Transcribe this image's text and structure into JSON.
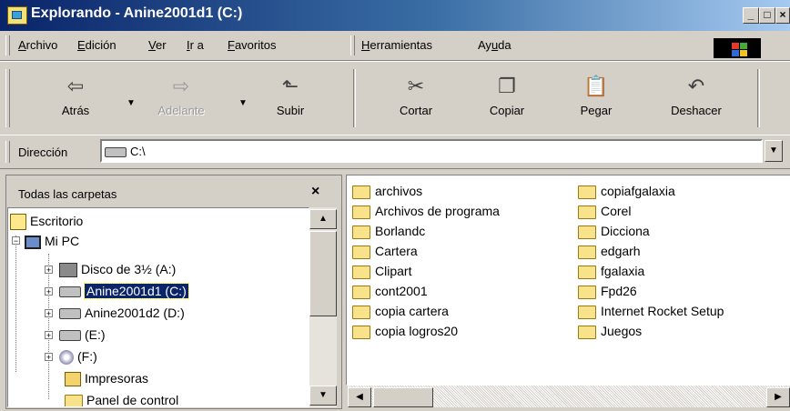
{
  "window": {
    "title": "Explorando - Anine2001d1 (C:)",
    "buttons": {
      "minimize": "_",
      "maximize": "□",
      "close": "×"
    }
  },
  "menu": [
    {
      "pre": "",
      "key": "A",
      "post": "rchivo"
    },
    {
      "pre": "",
      "key": "E",
      "post": "dición"
    },
    {
      "pre": "",
      "key": "V",
      "post": "er"
    },
    {
      "pre": "",
      "key": "I",
      "post": "r a"
    },
    {
      "pre": "",
      "key": "F",
      "post": "avoritos"
    },
    {
      "pre": "",
      "key": "H",
      "post": "erramientas"
    },
    {
      "pre": "Ay",
      "key": "u",
      "post": "da"
    }
  ],
  "toolbar": {
    "back": {
      "label": "Atrás",
      "icon": "⇦"
    },
    "forward": {
      "label": "Adelante",
      "icon": "⇨"
    },
    "up": {
      "label": "Subir",
      "icon": "⬑"
    },
    "cut": {
      "label": "Cortar",
      "icon": "✂"
    },
    "copy": {
      "label": "Copiar",
      "icon": "❐"
    },
    "paste": {
      "label": "Pegar",
      "icon": "📋"
    },
    "undo": {
      "label": "Deshacer",
      "icon": "↶"
    },
    "dropdown": "▼"
  },
  "address": {
    "label": "Dirección",
    "value": "C:\\",
    "dropdown": "▼"
  },
  "left_pane": {
    "title": "Todas las carpetas",
    "close": "×",
    "tree": [
      {
        "label": "Escritorio"
      },
      {
        "label": "Mi PC"
      },
      {
        "label": "Disco de 3½ (A:)"
      },
      {
        "label": "Anine2001d1 (C:)"
      },
      {
        "label": "Anine2001d2 (D:)"
      },
      {
        "label": "(E:)"
      },
      {
        "label": "(F:)"
      },
      {
        "label": "Impresoras"
      },
      {
        "label": "Panel de control"
      }
    ],
    "scroll": {
      "up": "▲",
      "down": "▼"
    }
  },
  "files": {
    "col1": [
      "archivos",
      "Archivos de programa",
      "Borlandc",
      "Cartera",
      "Clipart",
      "cont2001",
      "copia cartera",
      "copia logros20"
    ],
    "col2": [
      "copiafgalaxia",
      "Corel",
      "Dicciona",
      "edgarh",
      "fgalaxia",
      "Fpd26",
      "Internet Rocket Setup",
      "Juegos"
    ]
  },
  "hscroll": {
    "left": "◀",
    "right": "▶"
  },
  "colors": {
    "title_bar": "#0a246a",
    "selection": "#0a246a",
    "face": "#d4d0c8"
  }
}
